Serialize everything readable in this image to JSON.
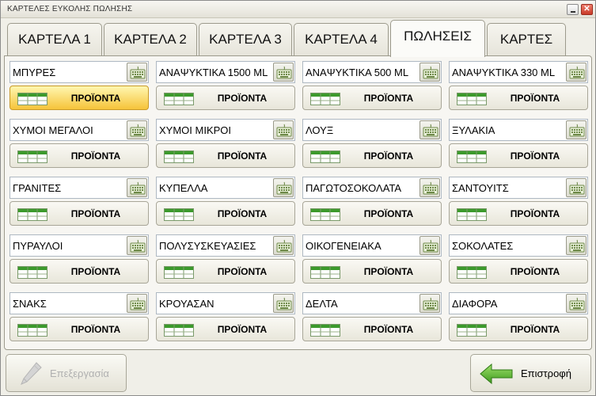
{
  "window": {
    "title": "ΚΑΡΤΕΛΕΣ ΕΥΚΟΛΗΣ ΠΩΛΗΣΗΣ",
    "minimize_icon": "minimize-icon",
    "close_glyph": "✕"
  },
  "tabs": [
    {
      "label": "ΚΑΡΤΕΛΑ 1",
      "active": false
    },
    {
      "label": "ΚΑΡΤΕΛΑ 2",
      "active": false
    },
    {
      "label": "ΚΑΡΤΕΛΑ 3",
      "active": false
    },
    {
      "label": "ΚΑΡΤΕΛΑ 4",
      "active": false
    },
    {
      "label": "ΠΩΛΗΣΕΙΣ",
      "active": true
    },
    {
      "label": "ΚΑΡΤΕΣ",
      "active": false
    }
  ],
  "products_button_label": "ΠΡΟΪΟΝΤΑ",
  "categories": [
    {
      "name": "ΜΠΥΡΕΣ",
      "highlighted": true
    },
    {
      "name": "ΑΝΑΨΥΚΤΙΚΑ 1500 ML",
      "highlighted": false
    },
    {
      "name": "ΑΝΑΨΥΚΤΙΚΑ 500 ML",
      "highlighted": false
    },
    {
      "name": "ΑΝΑΨΥΚΤΙΚΑ 330 ML",
      "highlighted": false
    },
    {
      "name": "ΧΥΜΟΙ ΜΕΓΑΛΟΙ",
      "highlighted": false
    },
    {
      "name": "ΧΥΜΟΙ ΜΙΚΡΟΙ",
      "highlighted": false
    },
    {
      "name": "ΛΟΥΞ",
      "highlighted": false
    },
    {
      "name": "ΞΥΛΑΚΙΑ",
      "highlighted": false
    },
    {
      "name": "ΓΡΑΝΙΤΕΣ",
      "highlighted": false
    },
    {
      "name": "ΚΥΠΕΛΛΑ",
      "highlighted": false
    },
    {
      "name": "ΠΑΓΩΤΟΣΟΚΟΛΑΤΑ",
      "highlighted": false
    },
    {
      "name": "ΣΑΝΤΟΥΙΤΣ",
      "highlighted": false
    },
    {
      "name": "ΠΥΡΑΥΛΟΙ",
      "highlighted": false
    },
    {
      "name": "ΠΟΛΥΣΥΣΚΕΥΑΣΙΕΣ",
      "highlighted": false
    },
    {
      "name": "ΟΙΚΟΓΕΝΕΙΑΚΑ",
      "highlighted": false
    },
    {
      "name": "ΣΟΚΟΛΑΤΕΣ",
      "highlighted": false
    },
    {
      "name": "ΣΝΑΚΣ",
      "highlighted": false
    },
    {
      "name": "ΚΡΟΥΑΣΑΝ",
      "highlighted": false
    },
    {
      "name": "ΔΕΛΤΑ",
      "highlighted": false
    },
    {
      "name": "ΔΙΑΦΟΡΑ",
      "highlighted": false
    }
  ],
  "footer": {
    "edit_label": "Επεξεργασία",
    "edit_enabled": false,
    "back_label": "Επιστροφή"
  },
  "colors": {
    "highlight": "#f6c33a",
    "table_icon_green": "#3c9a2c",
    "back_arrow_green": "#4caa2a"
  }
}
